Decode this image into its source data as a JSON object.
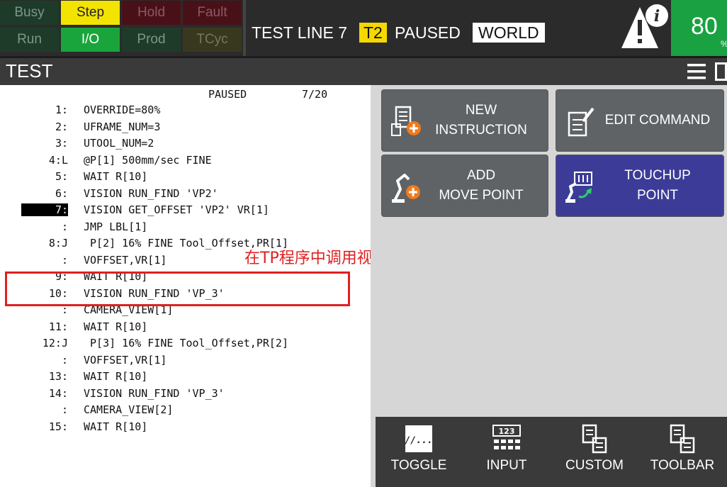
{
  "leds": [
    {
      "label": "Busy",
      "bg": "#1e3b2a",
      "fg": "#7d9687"
    },
    {
      "label": "Step",
      "bg": "#f3e300",
      "fg": "#222222"
    },
    {
      "label": "Hold",
      "bg": "#4a1018",
      "fg": "#8a5a60"
    },
    {
      "label": "Fault",
      "bg": "#4a1018",
      "fg": "#8a5a60"
    },
    {
      "label": "Run",
      "bg": "#1e3b2a",
      "fg": "#7d9687"
    },
    {
      "label": "I/O",
      "bg": "#19a53c",
      "fg": "#ffffff"
    },
    {
      "label": "Prod",
      "bg": "#1e3b2a",
      "fg": "#7d9687"
    },
    {
      "label": "TCyc",
      "bg": "#38381e",
      "fg": "#77775a"
    }
  ],
  "status": {
    "program": "TEST LINE 7",
    "mode": "T2",
    "state": "PAUSED",
    "frame": "WORLD"
  },
  "override": {
    "value": "80",
    "unit": "%"
  },
  "title": "TEST",
  "listing": {
    "state": "PAUSED",
    "position": "7/20",
    "lines": [
      {
        "num": "1:",
        "text": "OVERRIDE=80%"
      },
      {
        "num": "2:",
        "text": "UFRAME_NUM=3"
      },
      {
        "num": "3:",
        "text": "UTOOL_NUM=2"
      },
      {
        "num": "4:L",
        "text": "@P[1] 500mm/sec FINE"
      },
      {
        "num": "5:",
        "text": "WAIT R[10]"
      },
      {
        "num": "6:",
        "text": "VISION RUN_FIND 'VP2'"
      },
      {
        "num": "7:",
        "text": "VISION GET_OFFSET 'VP2' VR[1]"
      },
      {
        "num": ":",
        "text": "JMP LBL[1]"
      },
      {
        "num": "8:J",
        "text": " P[2] 16% FINE Tool_Offset,PR[1]"
      },
      {
        "num": ":",
        "text": "VOFFSET,VR[1]"
      },
      {
        "num": "9:",
        "text": "WAIT R[10]"
      },
      {
        "num": "10:",
        "text": "VISION RUN_FIND 'VP_3'"
      },
      {
        "num": ":",
        "text": "CAMERA_VIEW[1]"
      },
      {
        "num": "11:",
        "text": "WAIT R[10]"
      },
      {
        "num": "12:J",
        "text": " P[3] 16% FINE Tool_Offset,PR[2]"
      },
      {
        "num": ":",
        "text": "VOFFSET,VR[1]"
      },
      {
        "num": "13:",
        "text": "WAIT R[10]"
      },
      {
        "num": "14:",
        "text": "VISION RUN_FIND 'VP_3'"
      },
      {
        "num": ":",
        "text": "CAMERA_VIEW[2]"
      },
      {
        "num": "15:",
        "text": "WAIT R[10]"
      }
    ]
  },
  "annotation": "在TP程序中调用视觉程序",
  "actions": {
    "new_instruction": [
      "NEW",
      "INSTRUCTION"
    ],
    "edit_command": "EDIT COMMAND",
    "add_move_point": [
      "ADD",
      "MOVE POINT"
    ],
    "touchup_point": [
      "TOUCHUP",
      "POINT"
    ]
  },
  "toolbar": {
    "toggle": "TOGGLE",
    "input": "INPUT",
    "input_icon_text": "123",
    "toggle_icon_text": "//...",
    "custom": "CUSTOM",
    "toolbar": "TOOLBAR"
  },
  "colors": {
    "accent_orange": "#f07a1a",
    "touchup_blue": "#3c3c98",
    "highlight_red": "#e02020"
  }
}
